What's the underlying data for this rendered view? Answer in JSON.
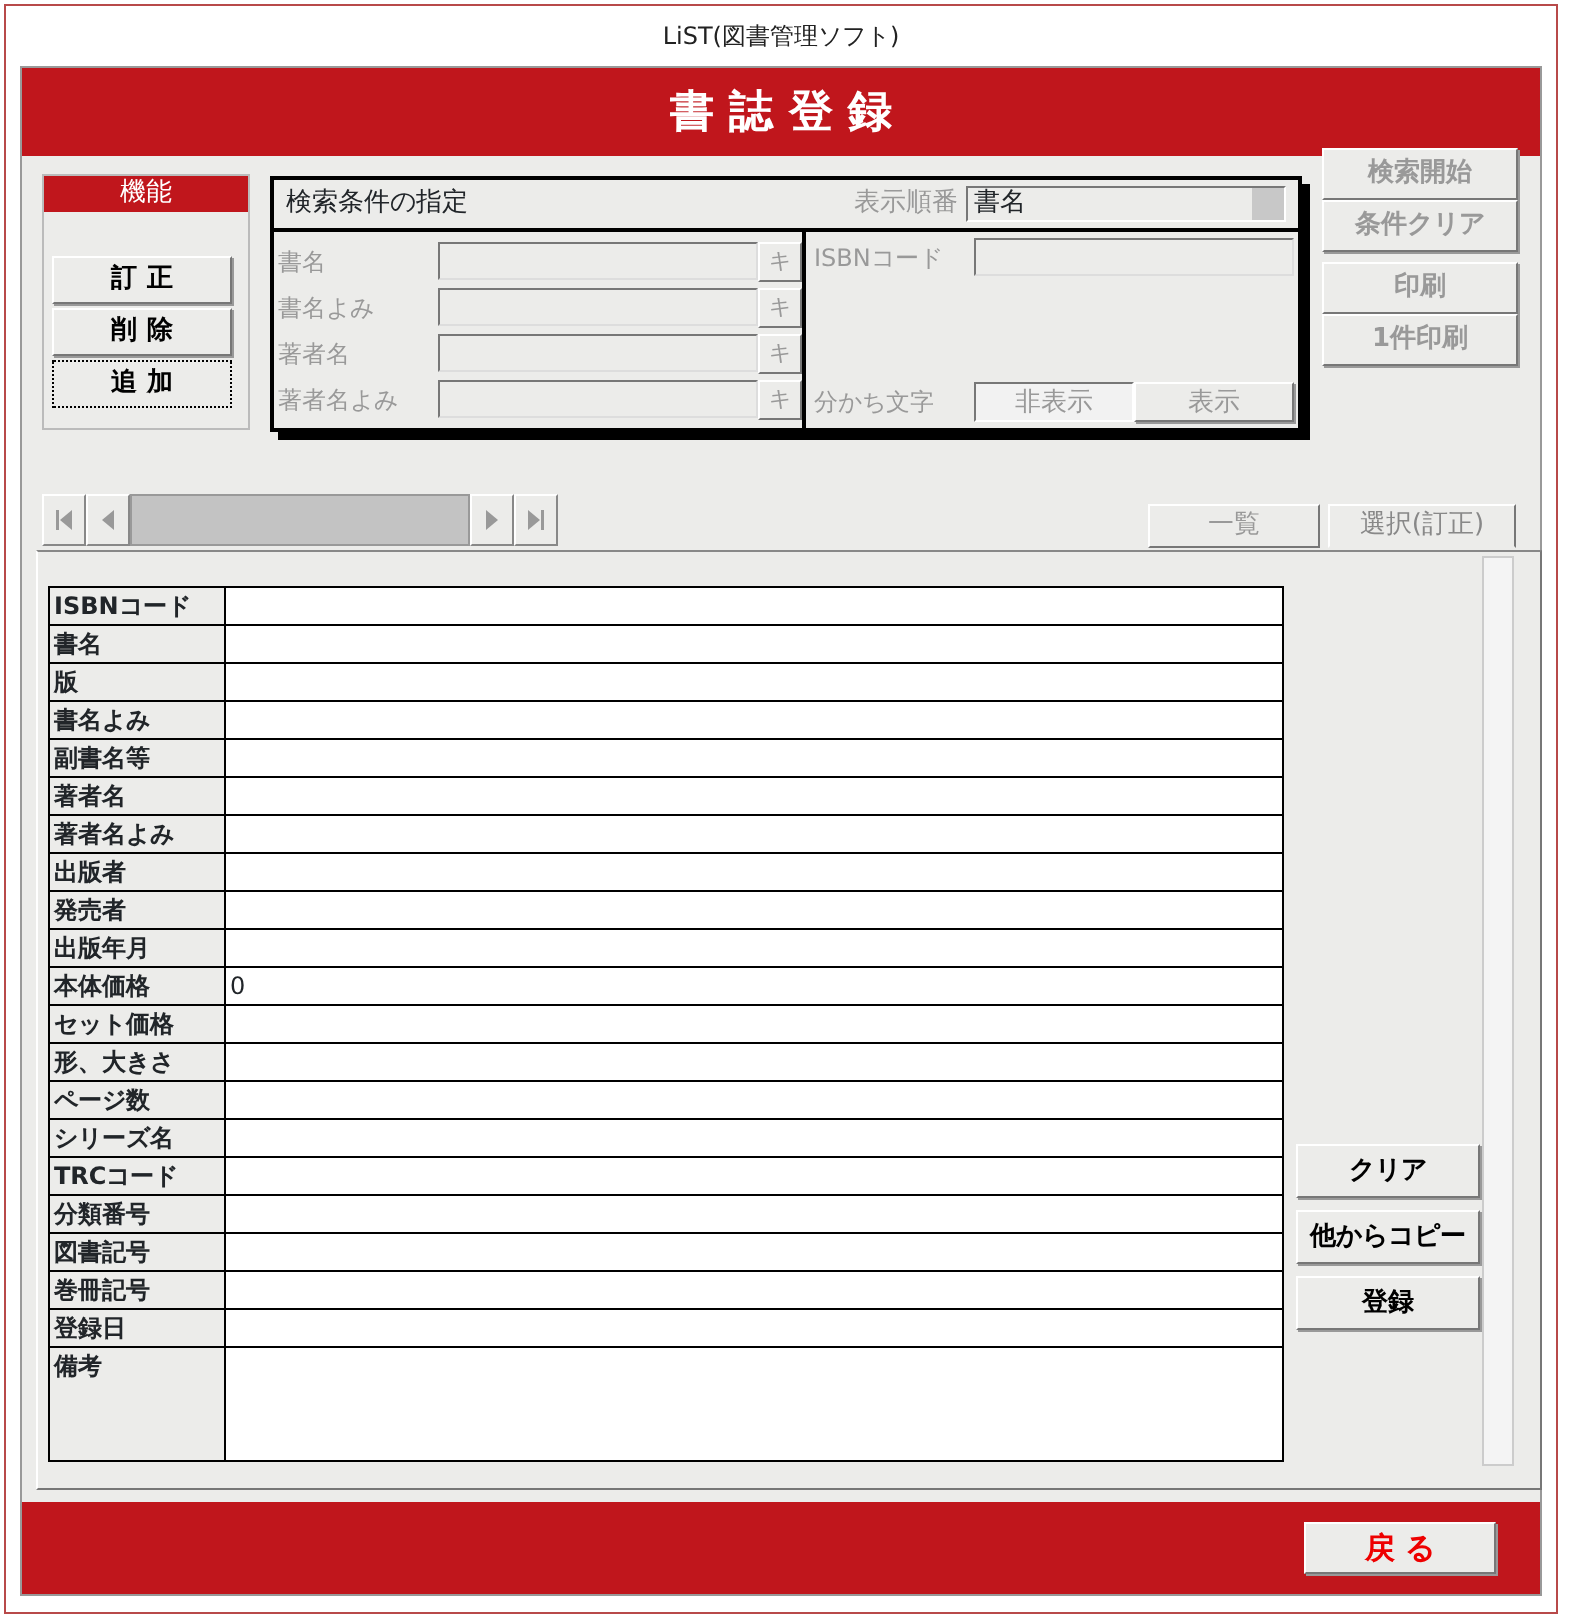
{
  "window": {
    "title": "LiST(図書管理ソフト)"
  },
  "header": {
    "title": "書 誌 登 録"
  },
  "functions": {
    "title": "機能",
    "buttons": [
      {
        "label": "訂 正",
        "selected": false
      },
      {
        "label": "削 除",
        "selected": false
      },
      {
        "label": "追 加",
        "selected": true
      }
    ]
  },
  "search": {
    "title": "検索条件の指定",
    "disabled": true,
    "sort_label": "表示順番",
    "sort_value": "書名",
    "fields": [
      {
        "label": "書名",
        "button": "キ"
      },
      {
        "label": "書名よみ",
        "button": "キ"
      },
      {
        "label": "著者名",
        "button": "キ"
      },
      {
        "label": "著者名よみ",
        "button": "キ"
      }
    ],
    "isbn_label": "ISBNコード",
    "separator_label": "分かち文字",
    "separator_options": [
      {
        "label": "非表示",
        "selected": true
      },
      {
        "label": "表示",
        "selected": false
      }
    ]
  },
  "search_buttons": [
    {
      "label": "検索開始",
      "disabled": true
    },
    {
      "label": "条件クリア",
      "disabled": true
    },
    {
      "label": "印刷",
      "disabled": true
    },
    {
      "label": "1件印刷",
      "disabled": true
    }
  ],
  "tabs": [
    {
      "label": "一覧",
      "selected": false
    },
    {
      "label": "選択(訂正)",
      "selected": true
    }
  ],
  "record": {
    "fields": [
      {
        "label": "ISBNコード"
      },
      {
        "label": "書名"
      },
      {
        "label": "版"
      },
      {
        "label": "書名よみ"
      },
      {
        "label": "副書名等"
      },
      {
        "label": "著者名"
      },
      {
        "label": "著者名よみ"
      },
      {
        "label": "出版者"
      },
      {
        "label": "発売者"
      },
      {
        "label": "出版年月"
      },
      {
        "label": "本体価格",
        "value": "0"
      },
      {
        "label": "セット価格"
      },
      {
        "label": "形、大きさ"
      },
      {
        "label": "ページ数"
      },
      {
        "label": "シリーズ名"
      },
      {
        "label": "TRCコード"
      },
      {
        "label": "分類番号"
      },
      {
        "label": "図書記号"
      },
      {
        "label": "巻冊記号"
      },
      {
        "label": "登録日"
      },
      {
        "label": "備考",
        "kind": "multiline"
      }
    ]
  },
  "actions": [
    "クリア",
    "他からコピー",
    "登録"
  ],
  "footer": {
    "back_button": "戻 る"
  }
}
